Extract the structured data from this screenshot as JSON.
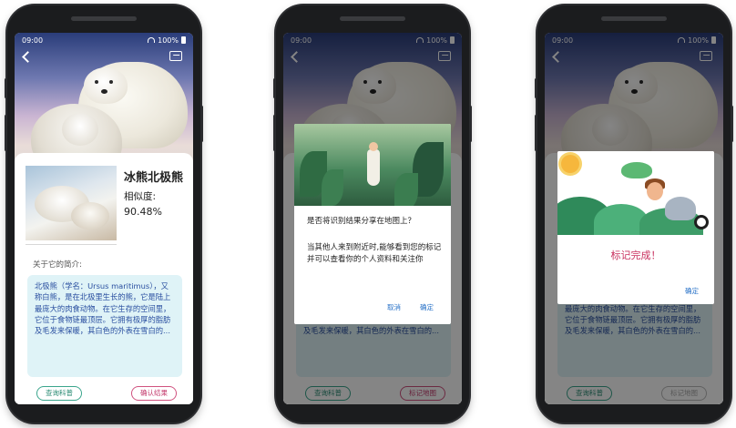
{
  "status": {
    "time": "09:00",
    "battery": "100%"
  },
  "result": {
    "animal_name": "冰熊北极熊",
    "similarity_label": "相似度:",
    "similarity_value": "90.48%",
    "intro_label": "关于它的简介:",
    "intro_text": "北极熊（学名：Ursus maritimus），又称白熊，是在北极里生长的熊，它是陆上最庞大的肉食动物。在它生存的空间里，它位于食物链最顶层。它拥有极厚的脂肪及毛发来保暖，其白色的外表在雪白的...",
    "query_button": "查询科普",
    "confirm_button": "确认结果",
    "mark_button": "标记地图"
  },
  "share_dialog": {
    "question": "是否将识别结果分享在地图上？",
    "text": "当其他人来到附近时,能够看到您的标记并可以查看你的个人资料和关注你",
    "cancel": "取消",
    "ok": "确定"
  },
  "done_dialog": {
    "title": "标记完成！",
    "ok": "确定"
  },
  "colors": {
    "accent_green": "#3aa58c",
    "accent_pink": "#d0527f",
    "link_blue": "#2a73c8",
    "intro_bg": "#dff3f7",
    "intro_text": "#2a4fa0",
    "done_text": "#c8305e"
  },
  "icons": [
    "back-icon",
    "photo-icon",
    "wifi-icon",
    "battery-icon"
  ]
}
